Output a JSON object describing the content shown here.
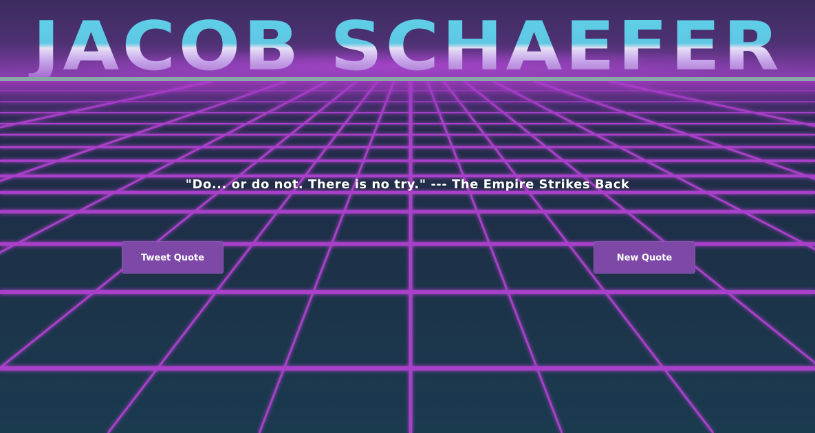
{
  "header": {
    "title": "JACOB SCHAEFER"
  },
  "quote": {
    "text": "\"Do... or do not. There is no try.\" --- The Empire Strikes Back"
  },
  "actions": {
    "tweet_label": "Tweet Quote",
    "new_label": "New Quote"
  },
  "colors": {
    "grid_line": "#a93fc9",
    "button_bg": "#7d48a6",
    "title_top": "#5fd0e8",
    "title_bottom": "#a060c8",
    "background": "#1a3347"
  }
}
